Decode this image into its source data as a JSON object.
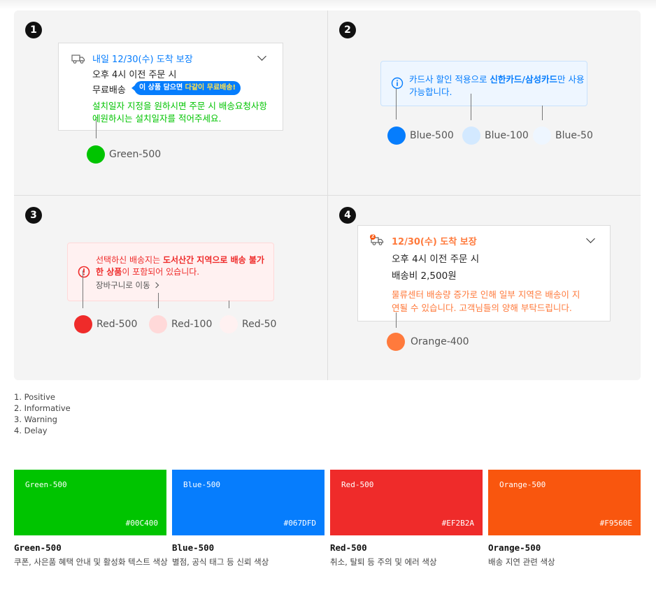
{
  "colors": {
    "green500": "#00C400",
    "blue500": "#067DFD",
    "blue100": "#D3E9FF",
    "blue50": "#EEF6FF",
    "red500": "#EF2B2A",
    "red100": "#FFD9D9",
    "red50": "#FFF1F1",
    "orange500": "#F9560E",
    "orange400": "#FF7A3C"
  },
  "icons": [
    "truck-icon",
    "info-icon",
    "warning-icon",
    "chevron-down-icon",
    "chevron-right-icon"
  ],
  "panel1": {
    "number": "1",
    "delivery_title": "내일 12/30(수) 도착 보장",
    "order_line": "오후 4시 이전 주문 시",
    "free_label": "무료배송",
    "tooltip_a": "이 상품 담으면 ",
    "tooltip_b": "다같이 무료배송!",
    "install_line1": "설치일자 지정을 원하시면 주문 시 배송요청사항",
    "install_line2": "에원하시는 설치일자를 적어주세요.",
    "swatch": "Green-500"
  },
  "panel2": {
    "number": "2",
    "info_a": "카드사 할인 적용으로 ",
    "info_b": "신한카드/삼성카드",
    "info_c": "만 사용",
    "info_line2": "가능합니다.",
    "swatches": [
      "Blue-500",
      "Blue-100",
      "Blue-50"
    ]
  },
  "panel3": {
    "number": "3",
    "warn_a": "선택하신 배송지는 ",
    "warn_b": "도서산간 지역으로 배송 불가",
    "warn_line2_b": "한 상품",
    "warn_line2_c": "이 포함되어 있습니다.",
    "link": "장바구니로 이동",
    "swatches": [
      "Red-500",
      "Red-100",
      "Red-50"
    ]
  },
  "panel4": {
    "number": "4",
    "badge": "2",
    "delivery_title": "12/30(수) 도착 보장",
    "order_line": "오후 4시 이전 주문 시",
    "fee_line": "배송비 2,500원",
    "delay_line1": "물류센터 배송량 증가로 인해 일부 지역은 배송이 지",
    "delay_line2": "연될 수 있습니다. 고객님들의 양해 부탁드립니다.",
    "swatch": "Orange-400"
  },
  "legend": [
    "1. Positive",
    "2. Informative",
    "3. Warning",
    "4. Delay"
  ],
  "blocks": [
    {
      "name": "Green-500",
      "hex": "#00C400",
      "title": "Green-500",
      "desc": "쿠폰, 사은품 혜택 안내 및 활성화 텍스트 색상"
    },
    {
      "name": "Blue-500",
      "hex": "#067DFD",
      "title": "Blue-500",
      "desc": "별점, 공식 태그 등 신뢰 색상"
    },
    {
      "name": "Red-500",
      "hex": "#EF2B2A",
      "title": "Red-500",
      "desc": "취소, 탈퇴 등 주의 및 에러 색상"
    },
    {
      "name": "Orange-500",
      "hex": "#F9560E",
      "title": "Orange-500",
      "desc": "배송 지연 관련 색상"
    }
  ]
}
